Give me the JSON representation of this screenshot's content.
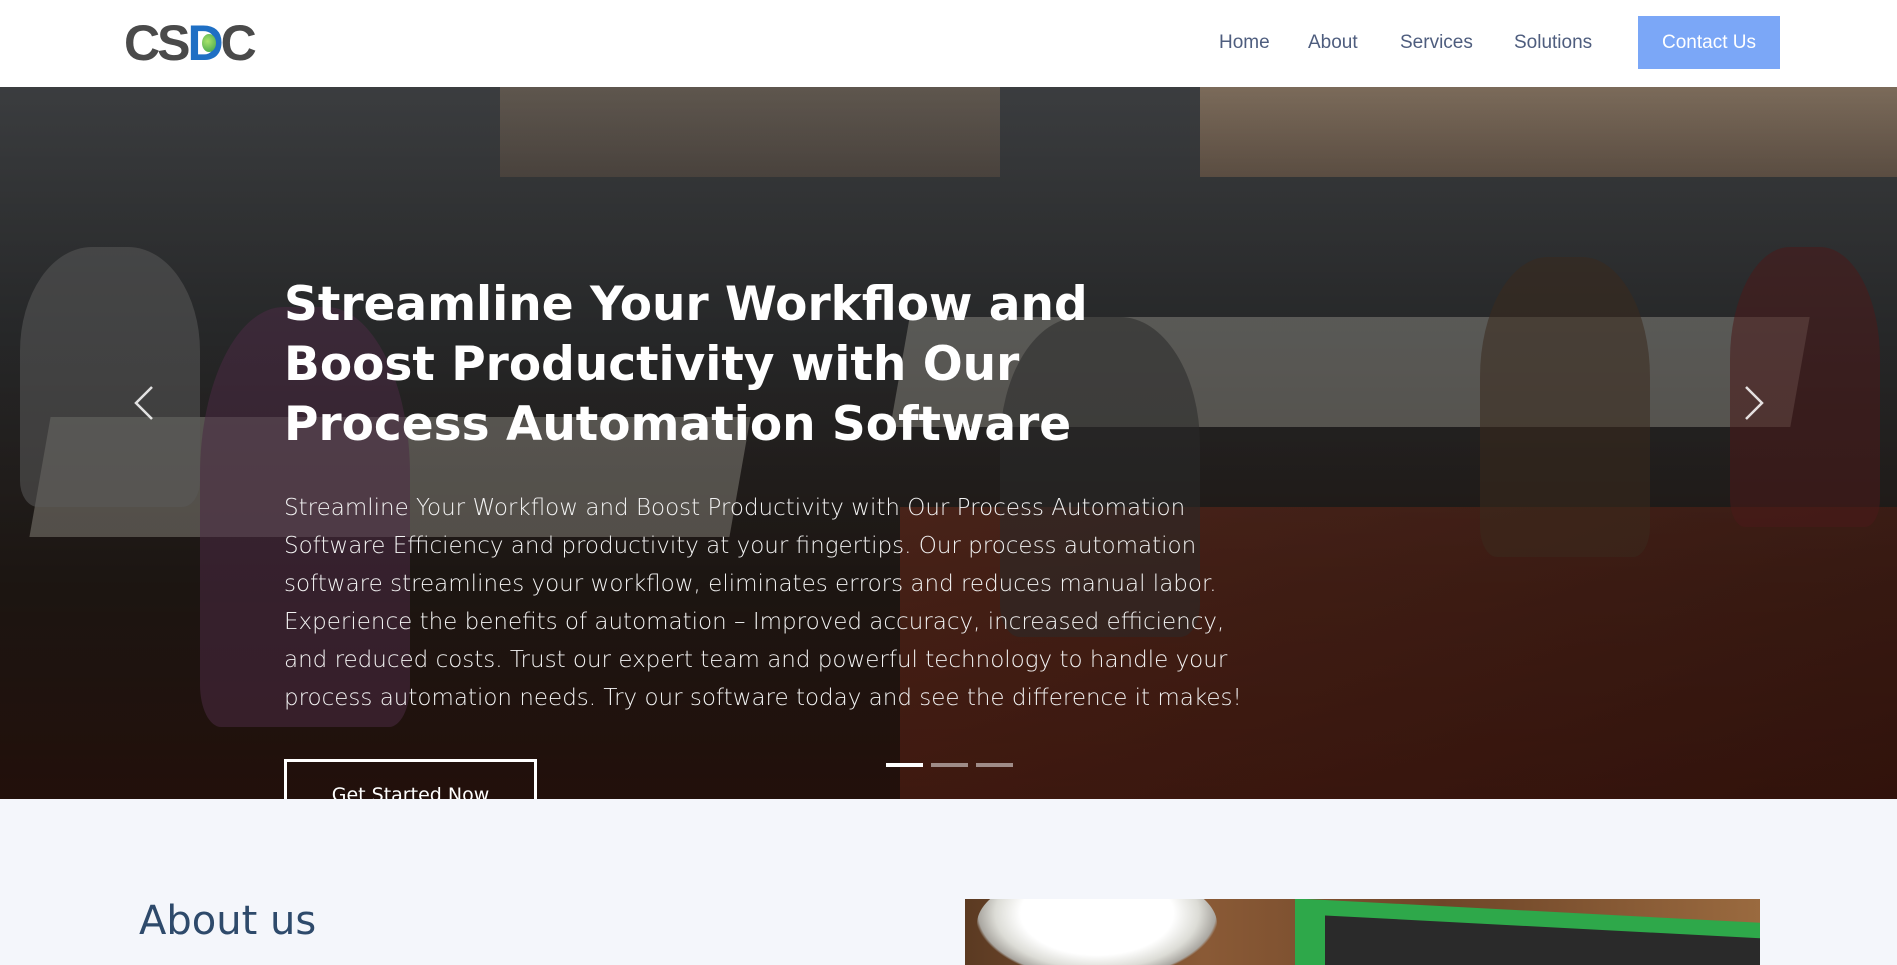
{
  "header": {
    "logo": {
      "text_left": "CS",
      "text_mid": "D",
      "text_right": "C"
    },
    "nav": {
      "home": "Home",
      "about": "About",
      "services": "Services",
      "solutions": "Solutions",
      "contact": "Contact Us"
    }
  },
  "hero": {
    "title": "Streamline Your Workflow and Boost Productivity with Our Process Automation Software",
    "text": "Streamline Your Workflow and Boost Productivity with Our Process Automation Software Efficiency and productivity at your fingertips. Our process automation software streamlines your workflow, eliminates errors and reduces manual labor. Experience the benefits of automation – Improved accuracy, increased efficiency, and reduced costs. Trust our expert team and powerful technology to handle your process automation needs. Try our software today and see the difference it makes!",
    "cta": "Get Started Now",
    "slides": {
      "count": 3,
      "active_index": 0
    }
  },
  "about": {
    "title": "About us"
  },
  "colors": {
    "accent": "#7ba7f7",
    "nav_text": "#4e5d7e",
    "heading": "#2e4a6b",
    "section_bg": "#f4f6fb"
  },
  "icons": {
    "prev": "chevron-left-icon",
    "next": "chevron-right-icon"
  }
}
